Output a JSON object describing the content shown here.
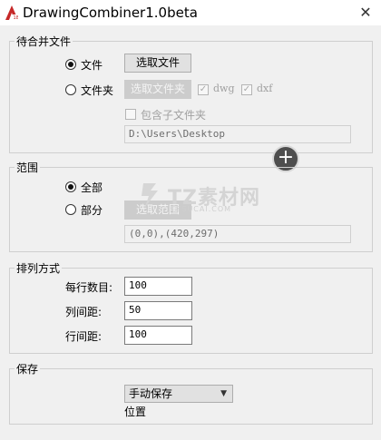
{
  "window": {
    "title": "DrawingCombiner1.0beta",
    "icon": "autocad-icon"
  },
  "merge_files": {
    "title": "待合并文件",
    "option_file": "文件",
    "option_folder": "文件夹",
    "select_file_button": "选取文件",
    "select_folder_button": "选取文件夹",
    "dwg_label": "dwg",
    "dxf_label": "dxf",
    "include_subfolders_label": "包含子文件夹",
    "path_value": "D:\\Users\\Desktop",
    "selected_option": "文件"
  },
  "range": {
    "title": "范围",
    "option_all": "全部",
    "option_part": "部分",
    "select_range_button": "选取范围",
    "coords_value": "(0,0),(420,297)",
    "selected_option": "全部"
  },
  "arrangement": {
    "title": "排列方式",
    "per_row_label": "每行数目:",
    "per_row_value": "100",
    "col_spacing_label": "列间距:",
    "col_spacing_value": "50",
    "row_spacing_label": "行间距:",
    "row_spacing_value": "100"
  },
  "save": {
    "title": "保存",
    "mode_value": "手动保存",
    "location_label": "位置"
  },
  "overlay": {
    "plus_icon": "plus-circle-icon"
  },
  "watermark": {
    "text": "TZ素材网",
    "subtext": "TZSUCAI.COM"
  },
  "colors": {
    "background": "#f0f0f0",
    "titlebar": "#ffffff",
    "disabled_button": "#cccccc",
    "plus_circle": "#4e4e4e"
  }
}
